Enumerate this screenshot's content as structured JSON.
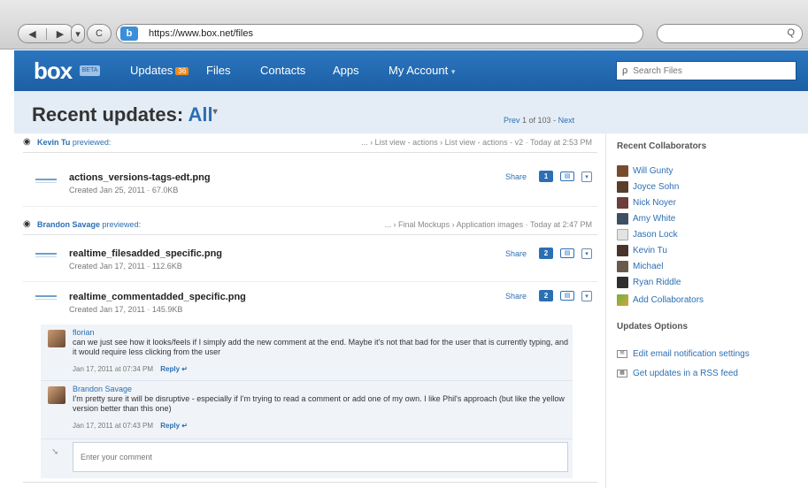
{
  "browser": {
    "url": "https://www.box.net/files",
    "back_glyph": "◀",
    "forward_glyph": "▶",
    "dropdown_glyph": "▾",
    "reload_glyph": "C",
    "favicon_letter": "b",
    "search_glyph": "Q"
  },
  "nav": {
    "logo": "box",
    "logo_tag": "BETA",
    "items": [
      {
        "label": "Updates",
        "badge": "36"
      },
      {
        "label": "Files"
      },
      {
        "label": "Contacts"
      },
      {
        "label": "Apps"
      },
      {
        "label": "My Account",
        "caret": "▾"
      }
    ],
    "search_placeholder": "Search Files",
    "search_glyph": "ρ"
  },
  "header": {
    "title": "Recent updates:",
    "filter": "All",
    "filter_caret": "▾",
    "pager_prev": "Prev",
    "pager_range": "1 of 103",
    "pager_sep": "-",
    "pager_next": "Next"
  },
  "feed": {
    "activities": [
      {
        "user": "Kevin Tu",
        "action": "previewed:",
        "path": "... › List view - actions › List view - actions - v2 · Today at 2:53 PM"
      },
      {
        "user": "Brandon Savage",
        "action": "previewed:",
        "path": "... › Final Mockups › Application images · Today at 2:47 PM"
      }
    ],
    "files": [
      {
        "name": "actions_versions-tags-edt.png",
        "meta": "Created Jan 25, 2011 · 67.0KB",
        "share": "Share",
        "comment_count": "1"
      },
      {
        "name": "realtime_filesadded_specific.png",
        "meta": "Created Jan 17, 2011 · 112.6KB",
        "share": "Share",
        "comment_count": "2"
      },
      {
        "name": "realtime_commentadded_specific.png",
        "meta": "Created Jan 17, 2011 · 145.9KB",
        "share": "Share",
        "comment_count": "2"
      }
    ],
    "comments": [
      {
        "author": "florian",
        "text": "can we just see how it looks/feels if I simply add the new comment at the end. Maybe it's not that bad for the user that is currently typing, and it would require less clicking from the user",
        "time": "Jan 17, 2011 at 07:34 PM",
        "reply": "Reply"
      },
      {
        "author": "Brandon Savage",
        "text": "I'm pretty sure it will be disruptive - especially if I'm trying to read a comment or add one of my own. I like Phil's approach (but like the yellow version better than this one)",
        "time": "Jan 17, 2011 at 07:43 PM",
        "reply": "Reply"
      }
    ],
    "comment_placeholder": "Enter your comment",
    "icon_glyphs": {
      "eye": "◉",
      "preview": "▤",
      "dropdown": "▾",
      "reply_arrow": "↵",
      "comment_arrow": "➘"
    }
  },
  "sidebar": {
    "collaborators_title": "Recent Collaborators",
    "collaborators": [
      "Will Gunty",
      "Joyce Sohn",
      "Nick Noyer",
      "Amy White",
      "Jason Lock",
      "Kevin Tu",
      "Michael",
      "Ryan Riddle",
      "Add Collaborators"
    ],
    "options_title": "Updates Options",
    "options": [
      "Edit email notification settings",
      "Get updates in a RSS feed"
    ]
  },
  "colors": {
    "accent": "#2c6fb3",
    "nav_bg": "#1c5fa4",
    "badge": "#f08a1c",
    "header_bg": "#e4edf6",
    "comment_bg": "#f0f4f8"
  }
}
